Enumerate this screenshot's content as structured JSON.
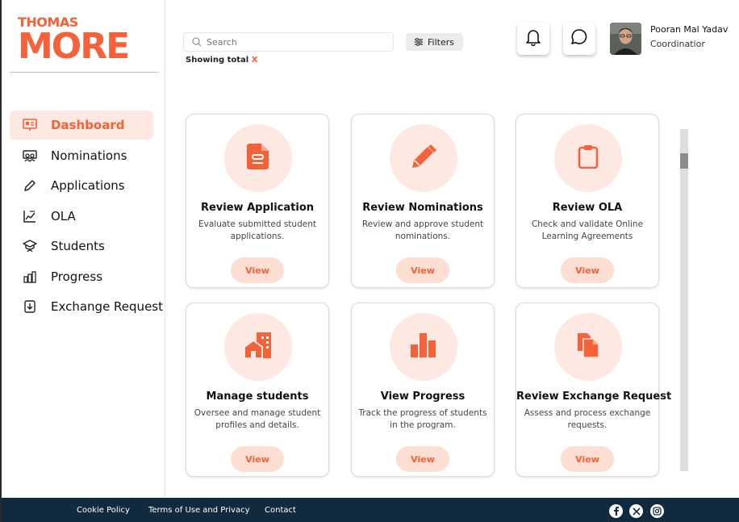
{
  "brand": {
    "line1": "THOMAS",
    "line2": "MORE",
    "color": "#f4623a"
  },
  "sidebar": {
    "items": [
      {
        "label": "Dashboard",
        "icon": "presentation-icon",
        "active": true
      },
      {
        "label": "Nominations",
        "icon": "users-group-icon"
      },
      {
        "label": "Applications",
        "icon": "pencil-icon"
      },
      {
        "label": "OLA",
        "icon": "line-chart-icon"
      },
      {
        "label": "Students",
        "icon": "graduation-cap-icon"
      },
      {
        "label": "Progress",
        "icon": "bar-chart-icon"
      },
      {
        "label": "Exchange Request",
        "icon": "download-doc-icon"
      }
    ]
  },
  "search": {
    "placeholder": "Search"
  },
  "filters": {
    "label": "Filters"
  },
  "showing": {
    "prefix": "Showing total",
    "value": "X"
  },
  "user": {
    "name": "Pooran Mal Yadav",
    "role": "Coordinatior"
  },
  "cards": [
    {
      "title": "Review Application",
      "desc": "Evaluate submitted student applications.",
      "button": "View",
      "icon": "document-icon"
    },
    {
      "title": "Review Nominations",
      "desc": "Review and approve student nominations.",
      "button": "View",
      "icon": "pencil-icon"
    },
    {
      "title": "Review OLA",
      "desc": "Check and validate Online Learning Agreements",
      "button": "View",
      "icon": "clipboard-icon"
    },
    {
      "title": "Manage students",
      "desc": "Oversee and manage student profiles and details.",
      "button": "View",
      "icon": "building-icon"
    },
    {
      "title": "View Progress",
      "desc": "Track the progress of students in the program.",
      "button": "View",
      "icon": "bar-chart-icon"
    },
    {
      "title": "Review Exchange Request",
      "desc": "Assess and process exchange requests.",
      "button": "View",
      "icon": "copy-document-icon"
    }
  ],
  "footer": {
    "links": [
      "Cookie Policy",
      "Terms of Use and Privacy",
      "Contact"
    ],
    "social": [
      "facebook-icon",
      "x-icon",
      "instagram-icon"
    ]
  }
}
